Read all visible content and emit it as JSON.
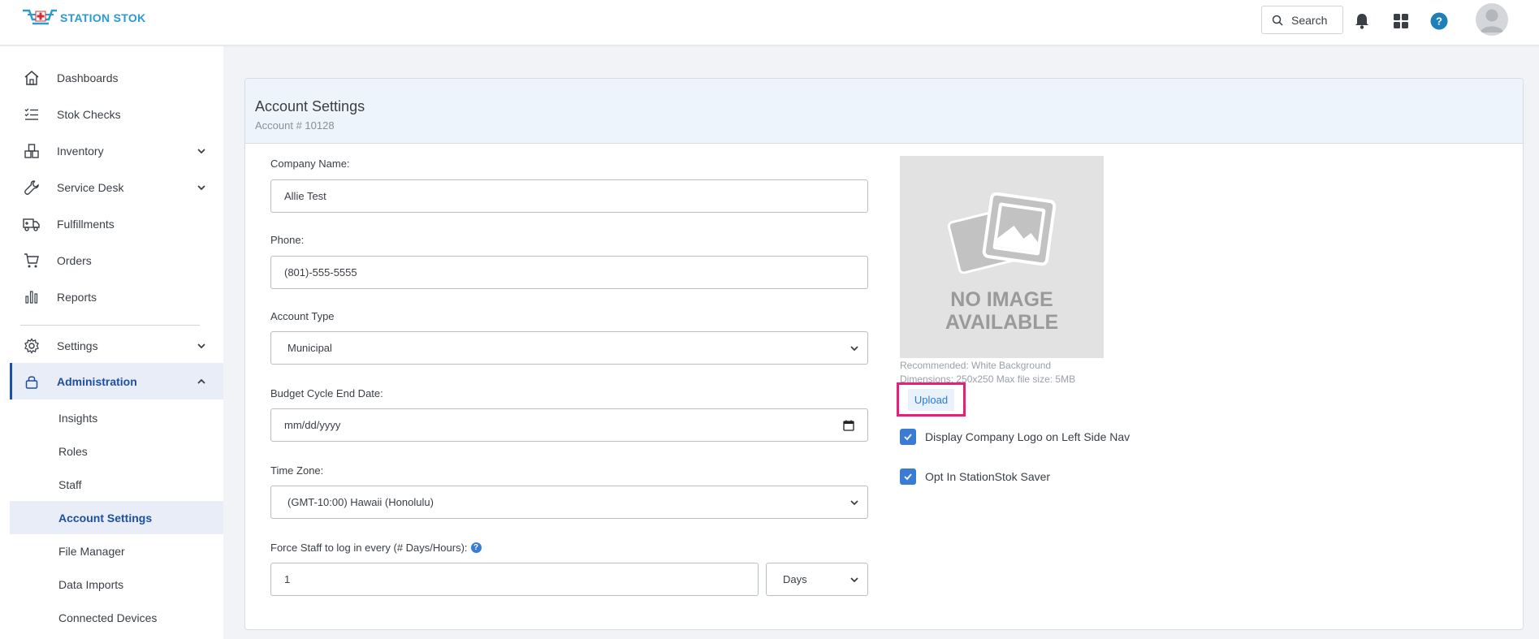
{
  "app": {
    "logo_text": "STATION STOK",
    "brand_color": "#2b9ad8"
  },
  "topbar": {
    "search_label": "Search"
  },
  "sidebar": {
    "items": [
      {
        "label": "Dashboards",
        "icon": "home-icon"
      },
      {
        "label": "Stok Checks",
        "icon": "checklist-icon"
      },
      {
        "label": "Inventory",
        "icon": "boxes-icon"
      },
      {
        "label": "Service Desk",
        "icon": "wrench-icon"
      },
      {
        "label": "Fulfillments",
        "icon": "truck-icon"
      },
      {
        "label": "Orders",
        "icon": "cart-icon"
      },
      {
        "label": "Reports",
        "icon": "bar-chart-icon"
      },
      {
        "label": "Settings",
        "icon": "gear-icon"
      },
      {
        "label": "Administration",
        "icon": "lock-icon"
      }
    ],
    "admin_sub": [
      {
        "label": "Insights"
      },
      {
        "label": "Roles"
      },
      {
        "label": "Staff"
      },
      {
        "label": "Account Settings"
      },
      {
        "label": "File Manager"
      },
      {
        "label": "Data Imports"
      },
      {
        "label": "Connected Devices"
      }
    ],
    "active_color": "#1e4fa0"
  },
  "card": {
    "title": "Account Settings",
    "account_number": "Account # 10128"
  },
  "form": {
    "company_name_label": "Company Name:",
    "company_name_value": "Allie Test",
    "phone_label": "Phone:",
    "phone_value": "(801)-555-5555",
    "account_type_label": "Account Type",
    "account_type_value": "Municipal",
    "budget_label": "Budget Cycle End Date:",
    "budget_placeholder": "mm/dd/yyyy",
    "timezone_label": "Time Zone:",
    "timezone_value": "(GMT-10:00) Hawaii (Honolulu)",
    "force_login_label": "Force Staff to log in every (# Days/Hours):",
    "force_login_value": "1",
    "force_login_unit": "Days"
  },
  "logo_panel": {
    "no_image_line1": "NO IMAGE",
    "no_image_line2": "AVAILABLE",
    "recommended": "Recommended: White Background",
    "dimensions": "Dimensions: 250x250 Max file size: 5MB",
    "upload_label": "Upload",
    "highlight_color": "#e91e7b",
    "display_logo_label": "Display Company Logo on Left Side Nav",
    "display_logo_checked": true,
    "saver_label": "Opt In StationStok Saver",
    "saver_checked": true
  }
}
